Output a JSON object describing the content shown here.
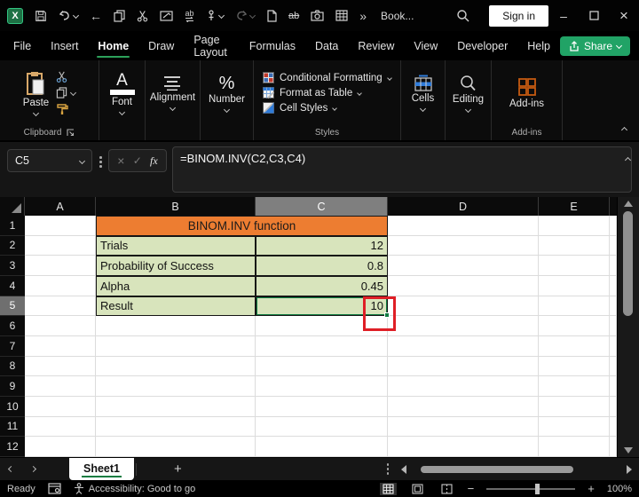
{
  "titlebar": {
    "title": "Book...",
    "sign_in_label": "Sign in",
    "more_commands": "»",
    "icons": [
      "excel-logo",
      "save",
      "undo",
      "back",
      "copy",
      "cut",
      "paste-special",
      "replace",
      "touch-mode",
      "redo",
      "new-file",
      "strikethrough",
      "screenshot",
      "format-table",
      "search",
      "minimize",
      "maximize",
      "close"
    ]
  },
  "glyphs": {
    "excel_x": "X",
    "back_arrow": "←",
    "ab": "ab",
    "letter_a": "A",
    "percent": "%",
    "cancel": "×",
    "check": "✓",
    "plus": "+",
    "minus": "−",
    "dash": "–",
    "close": "×"
  },
  "ribbon": {
    "tabs": [
      {
        "label": "File"
      },
      {
        "label": "Insert"
      },
      {
        "label": "Home",
        "active": true
      },
      {
        "label": "Draw"
      },
      {
        "label": "Page Layout"
      },
      {
        "label": "Formulas"
      },
      {
        "label": "Data"
      },
      {
        "label": "Review"
      },
      {
        "label": "View"
      },
      {
        "label": "Developer"
      },
      {
        "label": "Help"
      }
    ],
    "share_label": "Share",
    "clipboard": {
      "paste_label": "Paste",
      "caption": "Clipboard"
    },
    "font": {
      "caption": "Font"
    },
    "alignment": {
      "caption": "Alignment"
    },
    "number": {
      "caption": "Number"
    },
    "styles": {
      "items": [
        {
          "label": "Conditional Formatting"
        },
        {
          "label": "Format as Table"
        },
        {
          "label": "Cell Styles"
        }
      ],
      "caption": "Styles"
    },
    "cells": {
      "caption": "Cells"
    },
    "editing": {
      "caption": "Editing"
    },
    "addins": {
      "button_label": "Add-ins",
      "caption": "Add-ins"
    }
  },
  "formula_bar": {
    "name_box": "C5",
    "fx_label": "fx",
    "formula": "=BINOM.INV(C2,C3,C4)"
  },
  "grid": {
    "columns": [
      "A",
      "B",
      "C",
      "D",
      "E"
    ],
    "selected_column": "C",
    "row_numbers": [
      "1",
      "2",
      "3",
      "4",
      "5",
      "6",
      "7",
      "8",
      "9",
      "10",
      "11",
      "12"
    ],
    "selected_row": "5",
    "selected_cell": "C5",
    "table": {
      "title": "BINOM.INV function",
      "rows": [
        {
          "label": "Trials",
          "value": "12"
        },
        {
          "label": "Probability of Success",
          "value": "0.8"
        },
        {
          "label": "Alpha",
          "value": "0.45"
        },
        {
          "label": "Result",
          "value": "10"
        }
      ]
    },
    "colors": {
      "title_fill": "#ED7D31",
      "data_fill": "#D8E4BC",
      "annotation_red": "#DF1F26",
      "selection_green": "#107C41"
    }
  },
  "sheet_bar": {
    "tabs": [
      {
        "label": "Sheet1",
        "active": true
      }
    ],
    "add_label": "+"
  },
  "status_bar": {
    "mode": "Ready",
    "accessibility": "Accessibility: Good to go",
    "zoom_level": "100%"
  }
}
